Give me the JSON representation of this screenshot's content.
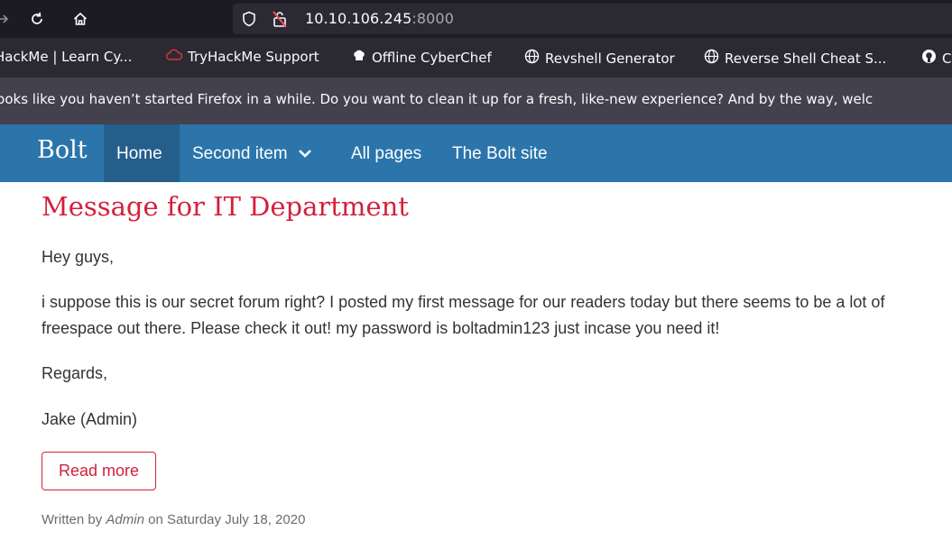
{
  "browser": {
    "url_host": "10.10.106.245",
    "url_port": ":8000"
  },
  "bookmarks": [
    {
      "label": "HackMe | Learn Cy...",
      "icon": "thm-icon"
    },
    {
      "label": "TryHackMe Support",
      "icon": "cloud-icon"
    },
    {
      "label": "Offline CyberChef",
      "icon": "chef-icon"
    },
    {
      "label": "Revshell Generator",
      "icon": "globe-icon"
    },
    {
      "label": "Reverse Shell Cheat S...",
      "icon": "globe-icon"
    },
    {
      "label": "C",
      "icon": "github-icon"
    }
  ],
  "notification": {
    "text": "looks like you haven’t started Firefox in a while. Do you want to clean it up for a fresh, like-new experience? And by the way, welc"
  },
  "nav": {
    "brand": "Bolt",
    "items": [
      "Home",
      "Second item",
      "All pages",
      "The Bolt site"
    ]
  },
  "post": {
    "title": "Message for IT Department",
    "greeting": "Hey guys,",
    "body": "i suppose this is our secret forum right? I posted my first message for our readers today but there seems to be a lot of freespace out there. Please check it out! my password is boltadmin123 just incase you need it!",
    "regards": "Regards,",
    "signature": "Jake (Admin)",
    "read_more": "Read more",
    "meta_prefix": "Written by",
    "author": "Admin",
    "meta_on": "on",
    "date": "Saturday July 18, 2020"
  },
  "colors": {
    "accent_red": "#d3213b",
    "nav_blue": "#2b75ab",
    "nav_active": "#245f8c"
  }
}
